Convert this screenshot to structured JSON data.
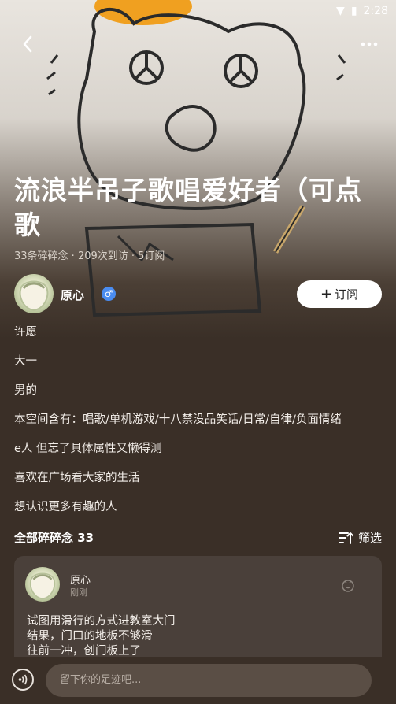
{
  "statusbar": {
    "time": "2:28"
  },
  "space": {
    "title": "流浪半吊子歌唱爱好者（可点歌",
    "stats": "33条碎碎念 · 209次到访 · 5订阅"
  },
  "owner": {
    "name": "原心",
    "gender": "♂",
    "subscribe_label": "订阅",
    "subscribe_icon": "plus-icon"
  },
  "bio": [
    "许愿",
    "大一",
    "男的",
    "本空间含有：唱歌/单机游戏/十八禁没品笑话/日常/自律/负面情绪",
    "e人 但忘了具体属性又懒得测",
    "喜欢在广场看大家的生活",
    "想认识更多有趣的人"
  ],
  "section": {
    "title": "全部碎碎念 33",
    "filter_label": "筛选"
  },
  "post": {
    "author": "原心",
    "time": "刚刚",
    "lines": [
      "试图用滑行的方式进教室大门",
      "结果，门口的地板不够滑",
      "往前一冲，创门板上了"
    ]
  },
  "footer": {
    "input_placeholder": "留下你的足迹吧..."
  },
  "colors": {
    "background": "#3a2f27",
    "accent_gender": "#4a8cf0",
    "card": "#4a403a"
  }
}
